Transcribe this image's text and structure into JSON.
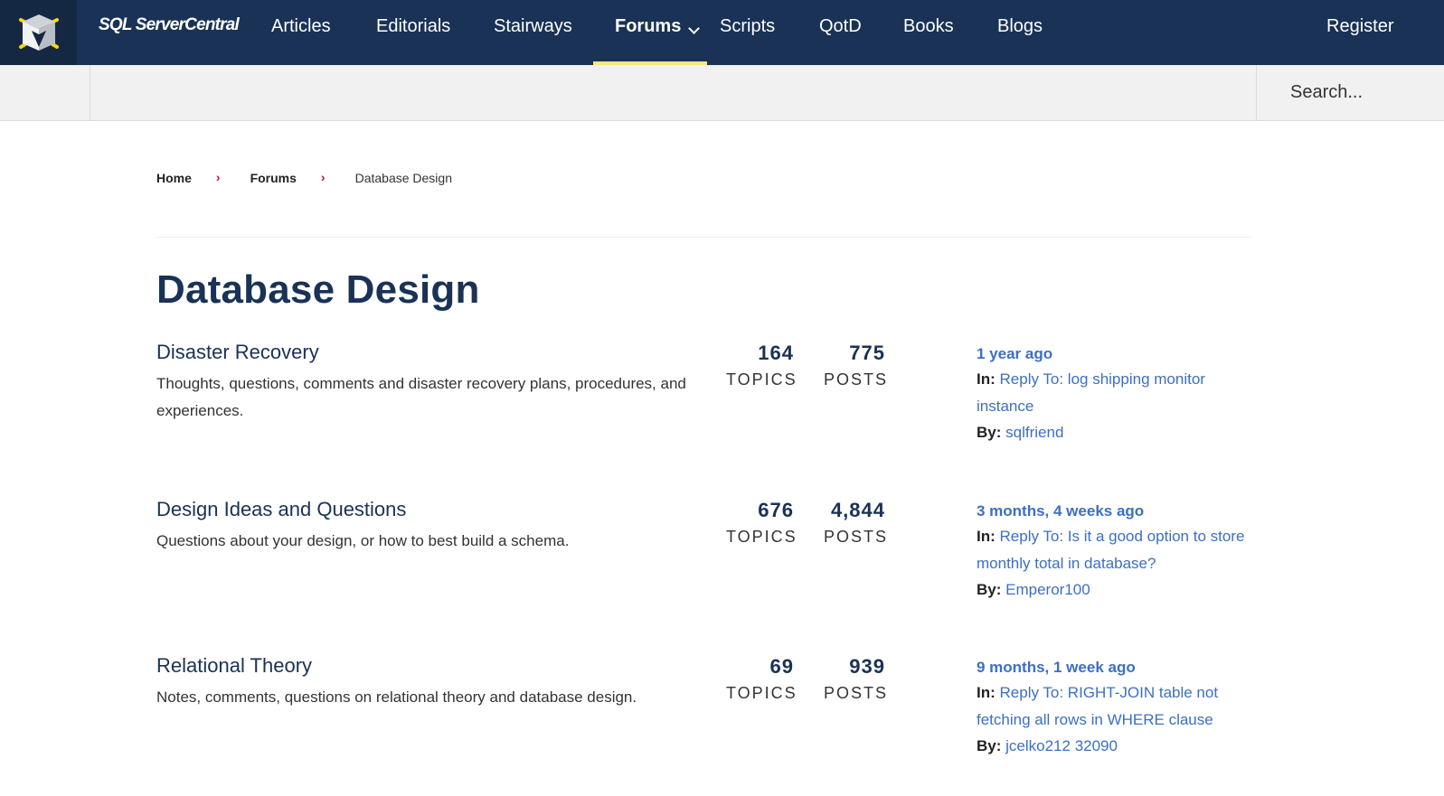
{
  "header": {
    "logo_icon": "cube-logo-icon",
    "brand": "SQL ServerCentral",
    "nav": [
      {
        "label": "Articles",
        "active": false
      },
      {
        "label": "Editorials",
        "active": false
      },
      {
        "label": "Stairways",
        "active": false
      },
      {
        "label": "Forums",
        "active": true,
        "has_dropdown": true
      },
      {
        "label": "Scripts",
        "active": false
      },
      {
        "label": "QotD",
        "active": false
      },
      {
        "label": "Books",
        "active": false
      },
      {
        "label": "Blogs",
        "active": false
      }
    ],
    "register_label": "Register",
    "accent_color": "#f9e582",
    "nav_bg": "#193255"
  },
  "search": {
    "placeholder": "Search...",
    "value": ""
  },
  "breadcrumb": [
    {
      "label": "Home",
      "link": true
    },
    {
      "label": "Forums",
      "link": true
    },
    {
      "label": "Database Design",
      "link": false
    }
  ],
  "breadcrumb_separator": "›",
  "page_title": "Database Design",
  "forums": [
    {
      "title": "Disaster Recovery",
      "description": "Thoughts, questions, comments and disaster recovery plans, procedures, and experiences.",
      "topics": "164",
      "topics_label": "TOPICS",
      "posts": "775",
      "posts_label": "POSTS",
      "last_post": {
        "time": "1 year ago",
        "in_label": "In:",
        "topic": "Reply To: log shipping monitor instance",
        "by_label": "By:",
        "author": "sqlfriend"
      }
    },
    {
      "title": "Design Ideas and Questions",
      "description": "Questions about your design, or how to best build a schema.",
      "topics": "676",
      "topics_label": "TOPICS",
      "posts": "4,844",
      "posts_label": "POSTS",
      "last_post": {
        "time": "3 months, 4 weeks ago",
        "in_label": "In:",
        "topic": "Reply To: Is it a good option to store monthly total in database?",
        "by_label": "By:",
        "author": "Emperor100"
      }
    },
    {
      "title": "Relational Theory",
      "description": "Notes, comments, questions on relational theory and database design.",
      "topics": "69",
      "topics_label": "TOPICS",
      "posts": "939",
      "posts_label": "POSTS",
      "last_post": {
        "time": "9 months, 1 week ago",
        "in_label": "In:",
        "topic": "Reply To: RIGHT-JOIN table not fetching all rows in WHERE clause",
        "by_label": "By:",
        "author": "jcelko212 32090"
      }
    }
  ]
}
